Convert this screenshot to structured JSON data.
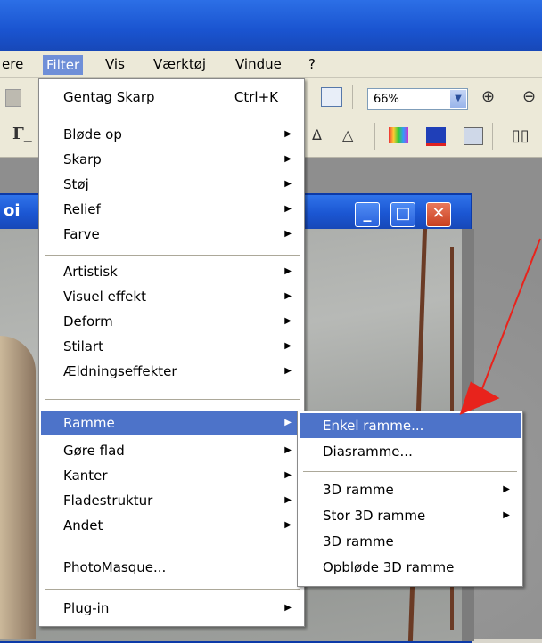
{
  "menubar": {
    "items": [
      "ere",
      "Filter",
      "Vis",
      "Værktøj",
      "Vindue",
      "?"
    ],
    "active": "Filter"
  },
  "toolbar": {
    "zoom": "66%"
  },
  "image_window": {
    "title": "oi"
  },
  "filter_menu": {
    "items": [
      {
        "label": "Gentag Skarp",
        "shortcut": "Ctrl+K"
      },
      {
        "label": "Bløde op",
        "submenu": true
      },
      {
        "label": "Skarp",
        "submenu": true
      },
      {
        "label": "Støj",
        "submenu": true
      },
      {
        "label": "Relief",
        "submenu": true
      },
      {
        "label": "Farve",
        "submenu": true
      },
      {
        "label": "Artistisk",
        "submenu": true
      },
      {
        "label": "Visuel effekt",
        "submenu": true
      },
      {
        "label": "Deform",
        "submenu": true
      },
      {
        "label": "Stilart",
        "submenu": true
      },
      {
        "label": "Ældningseffekter",
        "submenu": true
      },
      {
        "label": "Ramme",
        "submenu": true,
        "highlighted": true
      },
      {
        "label": "Gøre flad",
        "submenu": true
      },
      {
        "label": "Kanter",
        "submenu": true
      },
      {
        "label": "Fladestruktur",
        "submenu": true
      },
      {
        "label": "Andet",
        "submenu": true
      },
      {
        "label": "PhotoMasque..."
      },
      {
        "label": "Plug-in",
        "submenu": true
      }
    ]
  },
  "ramme_submenu": {
    "items": [
      {
        "label": "Enkel ramme...",
        "highlighted": true
      },
      {
        "label": "Diasramme..."
      },
      {
        "label": "3D ramme",
        "submenu": true
      },
      {
        "label": "Stor 3D ramme",
        "submenu": true
      },
      {
        "label": "3D ramme"
      },
      {
        "label": "Opbløde 3D ramme"
      }
    ]
  },
  "colors": {
    "highlight": "#4d73c9",
    "titlebar": "#1a54d0",
    "annotation_arrow": "#e8231c"
  },
  "icons": {
    "submenu": "triangle-right-icon",
    "window_min": "minimize-icon",
    "window_max": "maximize-icon",
    "window_close": "close-icon",
    "zoom_in": "zoom-in-icon",
    "zoom_out": "zoom-out-icon"
  }
}
